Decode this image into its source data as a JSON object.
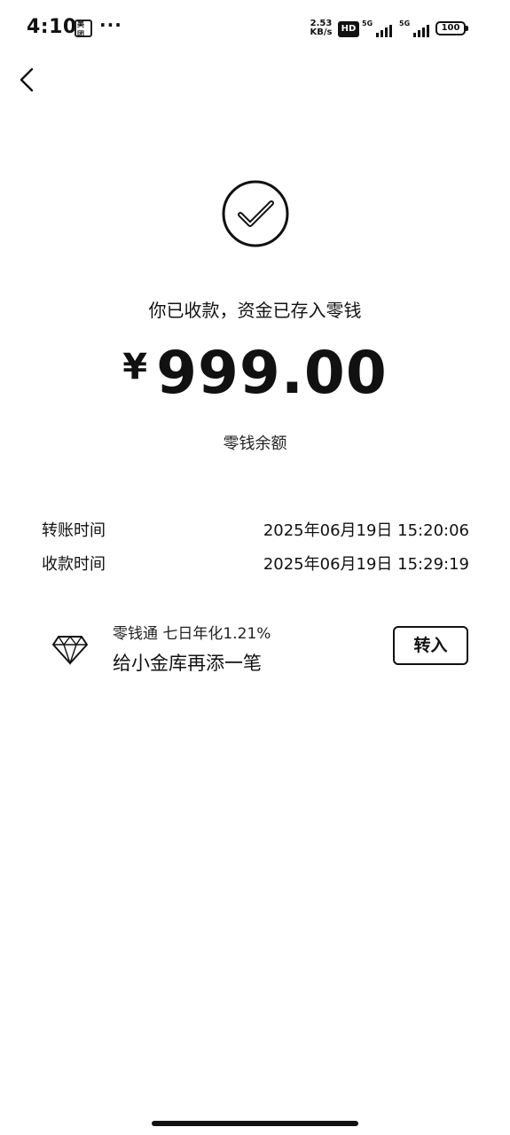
{
  "status_bar": {
    "time": "4:10",
    "app_badge": "美团",
    "more": "···",
    "speed_value": "2.53",
    "speed_unit": "KB/s",
    "hd": "HD",
    "network_1": "5G",
    "network_2": "5G",
    "battery": "100"
  },
  "result": {
    "message": "你已收款，资金已存入零钱",
    "currency": "¥",
    "amount": "999.00",
    "balance_label": "零钱余额"
  },
  "details": [
    {
      "label": "转账时间",
      "value": "2025年06月19日 15:20:06"
    },
    {
      "label": "收款时间",
      "value": "2025年06月19日 15:29:19"
    }
  ],
  "promo": {
    "subtitle": "零钱通 七日年化1.21%",
    "title": "给小金库再添一笔",
    "button_label": "转入",
    "icon": "diamond-icon"
  },
  "icons": {
    "back": "chevron-left-icon",
    "success": "check-circle-icon"
  },
  "colors": {
    "text": "#111111",
    "background": "#ffffff"
  }
}
